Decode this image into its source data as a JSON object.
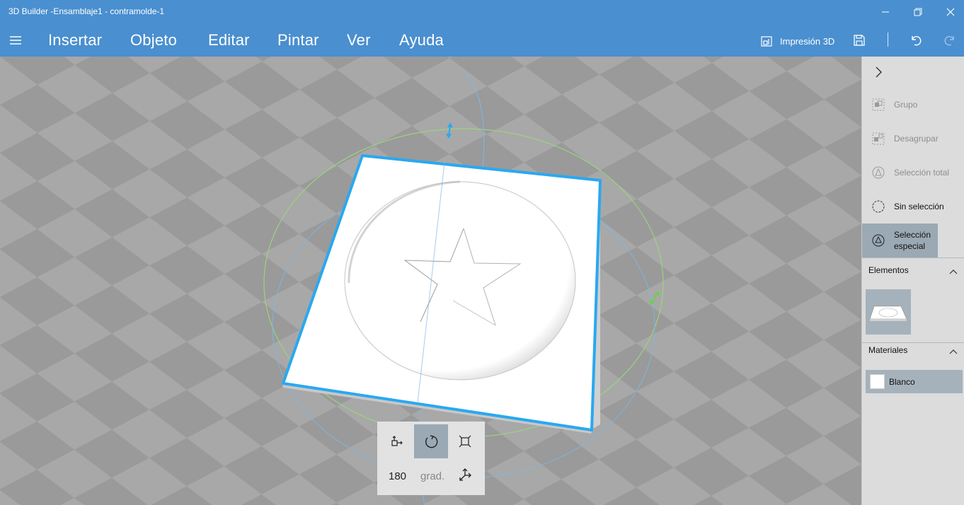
{
  "window": {
    "title": "3D Builder -Ensamblaje1 - contramolde-1",
    "minimize_icon": "minimize-icon",
    "restore_icon": "restore-icon",
    "close_icon": "close-icon"
  },
  "menubar": {
    "items": [
      "Insertar",
      "Objeto",
      "Editar",
      "Pintar",
      "Ver",
      "Ayuda"
    ],
    "print_label": "Impresión 3D",
    "icons": [
      "hamburger-icon",
      "printer-icon",
      "save-icon",
      "undo-icon",
      "redo-icon"
    ]
  },
  "transform_panel": {
    "modes": [
      "move",
      "rotate",
      "scale"
    ],
    "active_mode": "rotate",
    "degrees_value": "180",
    "degrees_unit": "grad."
  },
  "side_panel": {
    "actions": [
      {
        "label": "Grupo",
        "enabled": false,
        "icon": "group-icon"
      },
      {
        "label": "Desagrupar",
        "enabled": false,
        "icon": "ungroup-icon"
      },
      {
        "label": "Selección total",
        "enabled": false,
        "icon": "select-all-icon"
      },
      {
        "label": "Sin selección",
        "enabled": true,
        "icon": "no-selection-icon"
      },
      {
        "label": "Selección especial",
        "enabled": true,
        "selected": true,
        "icon": "special-selection-icon"
      }
    ],
    "elements_title": "Elementos",
    "materials_title": "Materiales",
    "material": {
      "name": "Blanco",
      "color": "#ffffff"
    }
  },
  "colors": {
    "accent": "#4a8fcf",
    "selection_outline": "#2aa8f0",
    "panel_selected": "#9aa9b4"
  }
}
